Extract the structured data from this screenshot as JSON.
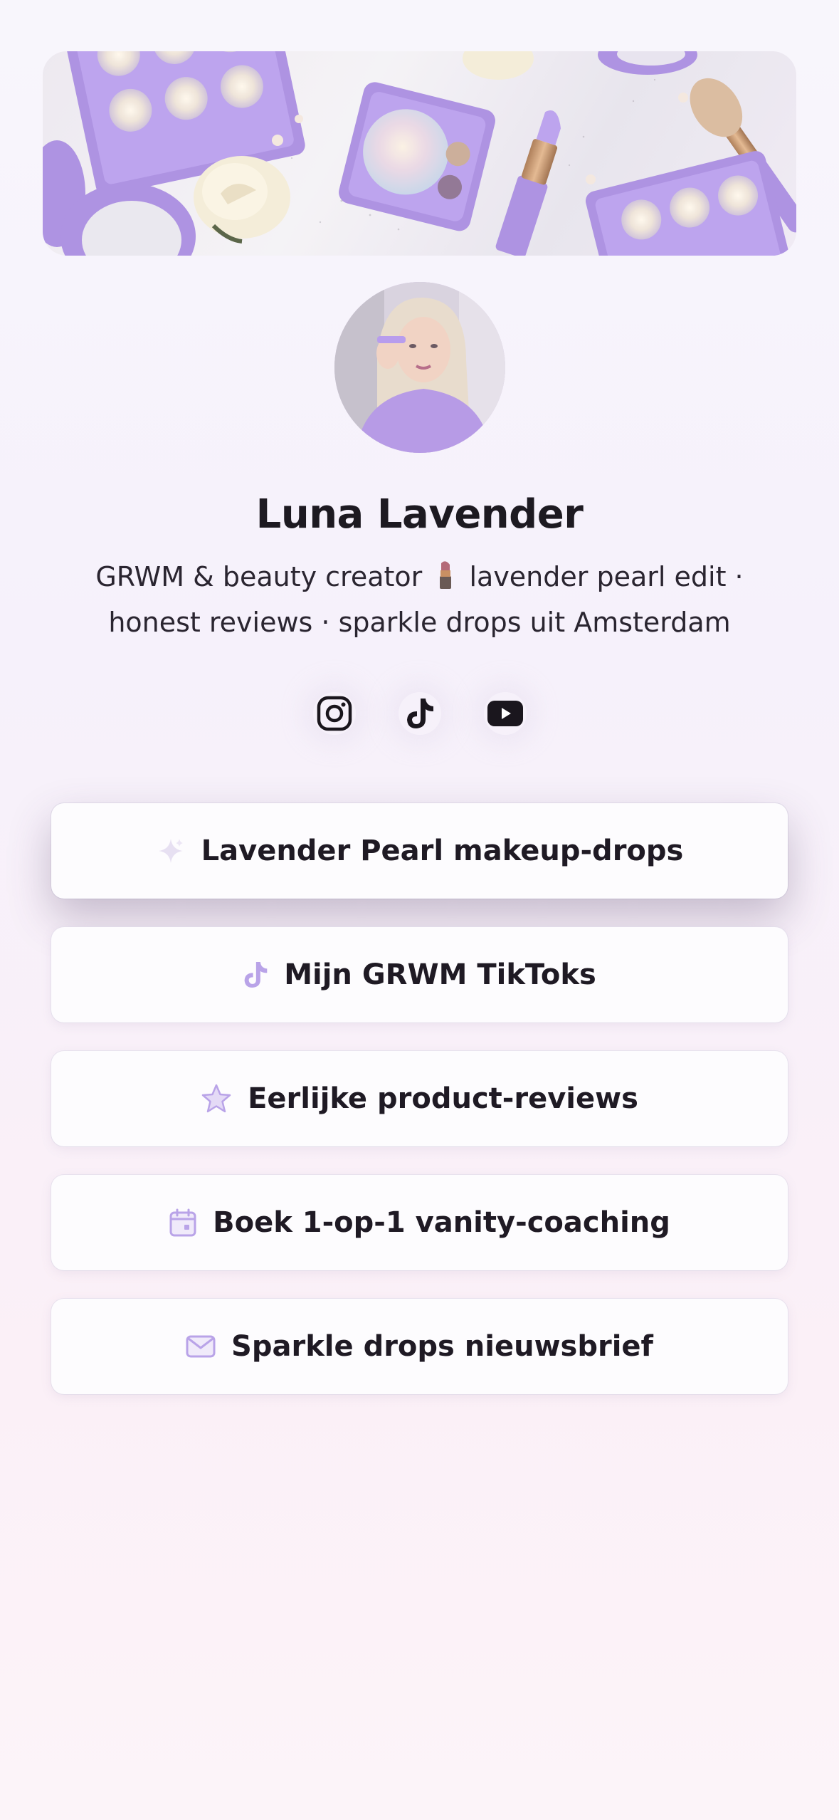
{
  "profile": {
    "name": "Luna Lavender",
    "bio_part1": "GRWM & beauty creator",
    "bio_part2": "lavender pearl edit · honest reviews · sparkle drops uit Amsterdam"
  },
  "socials": [
    {
      "icon": "instagram-icon"
    },
    {
      "icon": "tiktok-icon"
    },
    {
      "icon": "youtube-icon"
    }
  ],
  "links": [
    {
      "label": "Lavender Pearl makeup-drops",
      "icon": "sparkle-icon"
    },
    {
      "label": "Mijn GRWM TikToks",
      "icon": "tiktok-icon"
    },
    {
      "label": "Eerlijke product-reviews",
      "icon": "star-icon"
    },
    {
      "label": "Boek 1-op-1 vanity-coaching",
      "icon": "calendar-icon"
    },
    {
      "label": "Sparkle drops nieuwsbrief",
      "icon": "mail-icon"
    }
  ],
  "colors": {
    "accent": "#b9a3e8",
    "palette_purple": "#a78be0",
    "text": "#1f1a24"
  }
}
